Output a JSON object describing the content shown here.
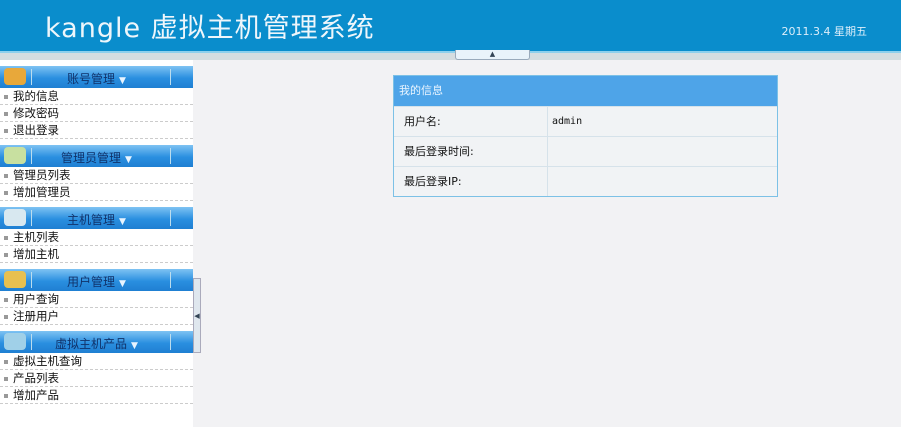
{
  "header": {
    "title": "kangle 虚拟主机管理系统",
    "date": "2011.3.4 星期五"
  },
  "sidebar": {
    "sections": [
      {
        "label": "账号管理",
        "icon": "book-icon",
        "color": "#e8a83a",
        "items": [
          "我的信息",
          "修改密码",
          "退出登录"
        ]
      },
      {
        "label": "管理员管理",
        "icon": "clipboard-icon",
        "color": "#c8e0a0",
        "items": [
          "管理员列表",
          "增加管理员"
        ]
      },
      {
        "label": "主机管理",
        "icon": "tools-icon",
        "color": "#d8e8f0",
        "items": [
          "主机列表",
          "增加主机"
        ]
      },
      {
        "label": "用户管理",
        "icon": "users-icon",
        "color": "#e8c050",
        "items": [
          "用户查询",
          "注册用户"
        ]
      },
      {
        "label": "虚拟主机产品",
        "icon": "monitor-icon",
        "color": "#a0d0e8",
        "items": [
          "虚拟主机查询",
          "产品列表",
          "增加产品"
        ]
      }
    ]
  },
  "panel": {
    "title": "我的信息",
    "rows": [
      {
        "label": "用户名:",
        "value": "admin"
      },
      {
        "label": "最后登录时间:",
        "value": ""
      },
      {
        "label": "最后登录IP:",
        "value": ""
      }
    ]
  }
}
